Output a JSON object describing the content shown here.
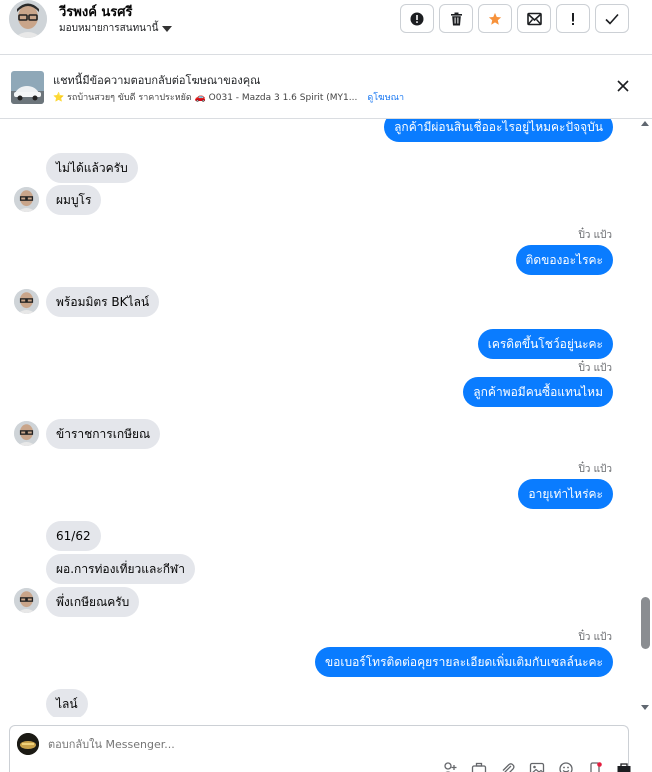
{
  "header": {
    "name": "วีรพงค์ นรศรี",
    "assign_label": "มอบหมายการสนทนานี้",
    "actions": [
      "alert-icon",
      "trash-icon",
      "star-icon",
      "mark-unread-icon",
      "spam-icon",
      "check-icon"
    ],
    "colors": {
      "star": "#f7923b",
      "accent": "#0a7cff"
    }
  },
  "banner": {
    "title": "แชทนี้มีข้อความตอบกลับต่อโฆษณาของคุณ",
    "subtitle": "⭐ รถบ้านสวยๆ ขับดี ราคาประหยัด 🚗 O031 - Mazda 3 1.6 Spirit (MY1...",
    "link": "ดูโฆษณา"
  },
  "messages": [
    {
      "side": "out",
      "text": "ลูกค้ามีผ่อนสินเชื่ออะไรอยู่ไหมคะปัจจุบัน"
    },
    {
      "side": "in",
      "text": "ไม่ได้แล้วครับ"
    },
    {
      "side": "in",
      "text": "ผมบูโร"
    },
    {
      "side": "out",
      "sender": "ปิ๋ว แป้ว",
      "text": "ติดของอะไรคะ"
    },
    {
      "side": "in",
      "text": "พร้อมมิตร BKไลน์"
    },
    {
      "side": "out",
      "text": "เครดิตขึ้นโชว์อยู่นะคะ"
    },
    {
      "side": "out",
      "sender": "ปิ๋ว แป้ว",
      "text": "ลูกค้าพอมีคนซื้อแทนไหม"
    },
    {
      "side": "in",
      "text": "ข้าราชการเกษียณ"
    },
    {
      "side": "out",
      "sender": "ปิ๋ว แป้ว",
      "text": "อายุเท่าไหร่คะ"
    },
    {
      "side": "in",
      "text": "61/62"
    },
    {
      "side": "in",
      "text": "ผอ.การท่องเที่ยวและกีฬา"
    },
    {
      "side": "in",
      "text": "พึ่งเกษียณครับ"
    },
    {
      "side": "out",
      "sender": "ปิ๋ว แป้ว",
      "text": "ขอเบอร์โทรติดต่อคุยรายละเอียดเพิ่มเติมกับเซลล์นะคะ"
    },
    {
      "side": "in",
      "text": "ไลน์"
    }
  ],
  "reply": {
    "placeholder": "ตอบกลับใน Messenger...",
    "tools": [
      "add-contact-icon",
      "briefcase-icon",
      "attachment-icon",
      "image-icon",
      "emoji-icon",
      "mobile-icon",
      "more-icon"
    ]
  }
}
